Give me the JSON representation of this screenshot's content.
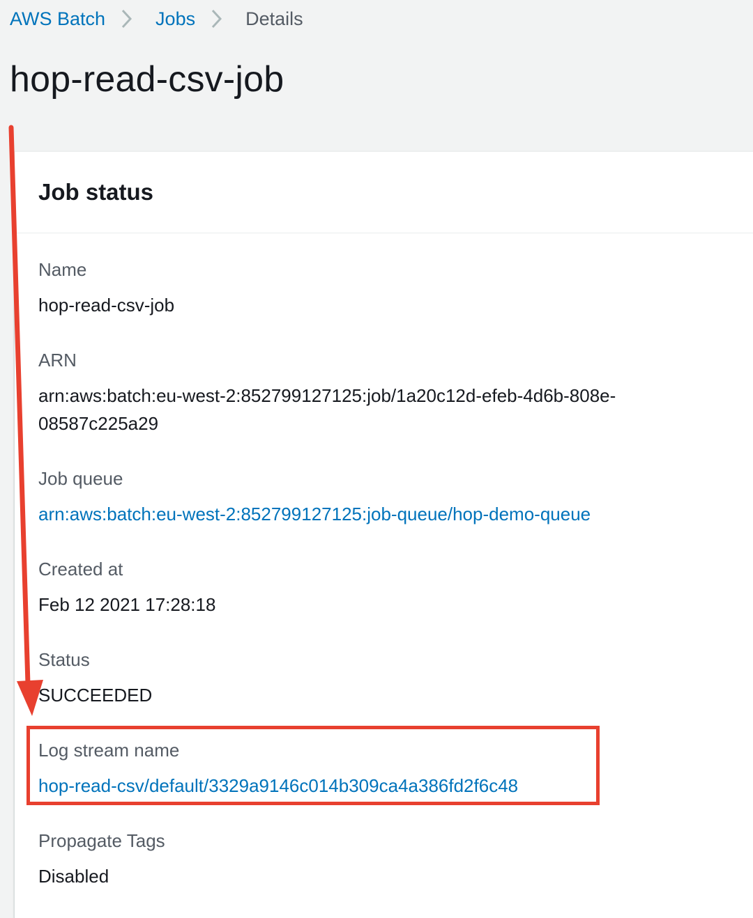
{
  "breadcrumb": {
    "items": [
      {
        "label": "AWS Batch"
      },
      {
        "label": "Jobs"
      },
      {
        "label": "Details"
      }
    ]
  },
  "page": {
    "title": "hop-read-csv-job"
  },
  "panel": {
    "title": "Job status",
    "fields": {
      "name": {
        "label": "Name",
        "value": "hop-read-csv-job"
      },
      "arn": {
        "label": "ARN",
        "value": "arn:aws:batch:eu-west-2:852799127125:job/1a20c12d-efeb-4d6b-808e-08587c225a29"
      },
      "job_queue": {
        "label": "Job queue",
        "value": "arn:aws:batch:eu-west-2:852799127125:job-queue/hop-demo-queue"
      },
      "created_at": {
        "label": "Created at",
        "value": "Feb 12 2021 17:28:18"
      },
      "status": {
        "label": "Status",
        "value": "SUCCEEDED"
      },
      "log_stream": {
        "label": "Log stream name",
        "value": "hop-read-csv/default/3329a9146c014b309ca4a386fd2f6c48"
      },
      "propagate_tags": {
        "label": "Propagate Tags",
        "value": "Disabled"
      }
    }
  },
  "colors": {
    "link": "#0073bb",
    "annotation": "#e8402f",
    "label": "#545b64",
    "text": "#16191f",
    "background": "#f2f3f3"
  }
}
